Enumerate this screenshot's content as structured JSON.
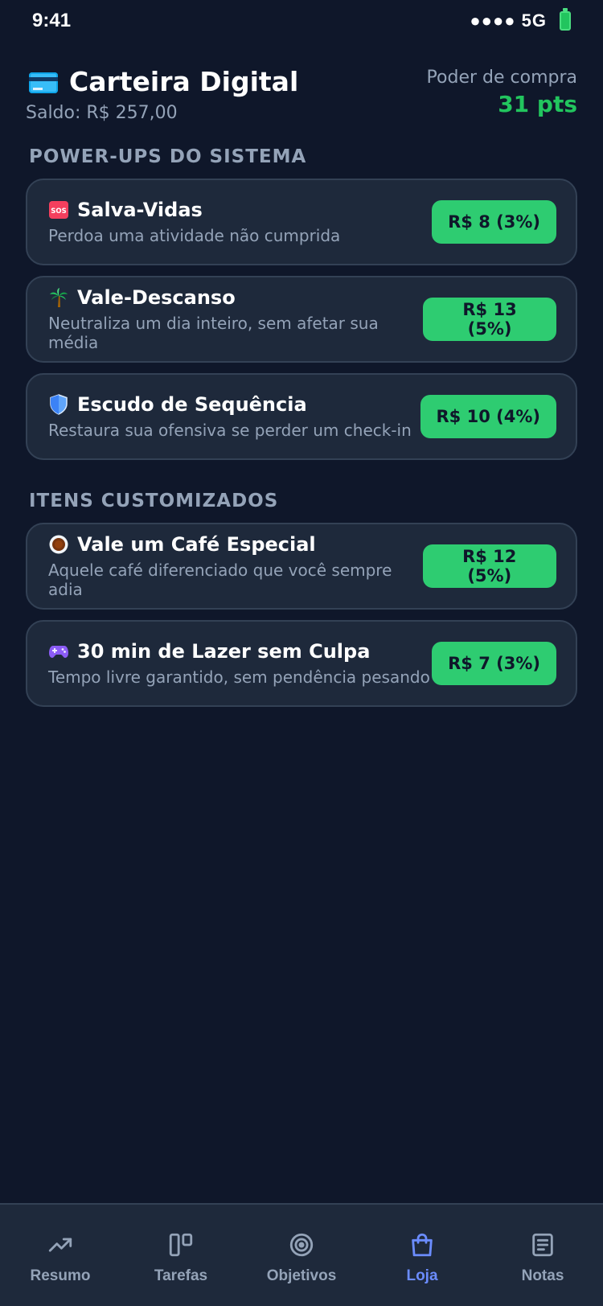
{
  "status_bar": {
    "time": "9:41",
    "signal": "●●●● 5G"
  },
  "header": {
    "icon": "credit-card-icon",
    "title": "Carteira Digital",
    "balance": "Saldo: R$ 257,00",
    "power_label": "Poder de compra",
    "power_value": "31 pts"
  },
  "sections": {
    "powerups": {
      "title": "POWER-UPS DO SISTEMA",
      "items": [
        {
          "icon": "sos-icon",
          "name": "Salva-Vidas",
          "description": "Perdoa uma atividade não cumprida",
          "price": "R$ 8 (3%)"
        },
        {
          "icon": "palm-tree-icon",
          "name": "Vale-Descanso",
          "description": "Neutraliza um dia inteiro, sem afetar sua média",
          "price": "R$ 13 (5%)"
        },
        {
          "icon": "shield-icon",
          "name": "Escudo de Sequência",
          "description": "Restaura sua ofensiva se perder um check-in",
          "price": "R$ 10 (4%)"
        }
      ]
    },
    "custom": {
      "title": "ITENS CUSTOMIZADOS",
      "items": [
        {
          "icon": "coffee-icon",
          "name": "Vale um Café Especial",
          "description": "Aquele café diferenciado que você sempre adia",
          "price": "R$ 12 (5%)"
        },
        {
          "icon": "gamepad-icon",
          "name": "30 min de Lazer sem Culpa",
          "description": "Tempo livre garantido, sem pendência pesando",
          "price": "R$ 7 (3%)"
        }
      ]
    }
  },
  "nav": {
    "items": [
      {
        "label": "Resumo",
        "icon": "trending-up-icon"
      },
      {
        "label": "Tarefas",
        "icon": "kanban-icon"
      },
      {
        "label": "Objetivos",
        "icon": "target-icon"
      },
      {
        "label": "Loja",
        "icon": "shopping-bag-icon",
        "active": true
      },
      {
        "label": "Notas",
        "icon": "notes-icon"
      }
    ]
  },
  "colors": {
    "background": "#0f172a",
    "card": "#1e293b",
    "accent_green": "#2ecc71",
    "active_nav": "#6b8cff",
    "muted": "#94a3b8"
  }
}
